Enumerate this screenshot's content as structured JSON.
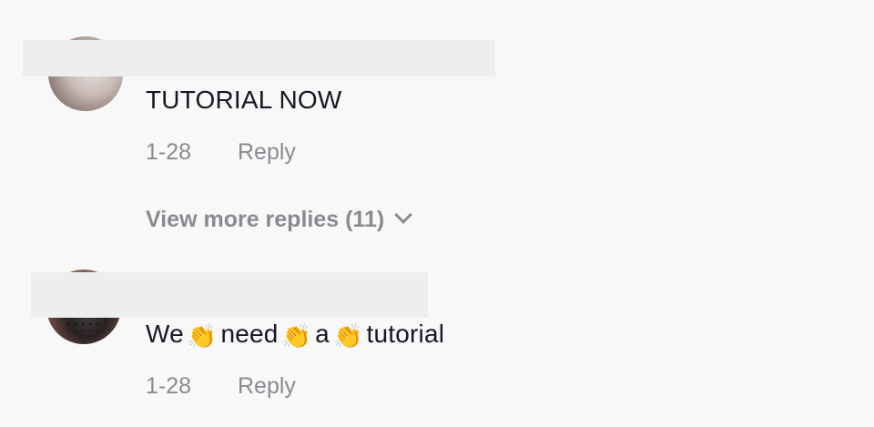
{
  "comments": [
    {
      "text": "TUTORIAL NOW",
      "date": "1-28",
      "reply_label": "Reply"
    },
    {
      "text_parts": [
        "We",
        "need",
        "a",
        "tutorial"
      ],
      "emoji": "👏",
      "date": "1-28",
      "reply_label": "Reply"
    }
  ],
  "view_more": {
    "label": "View more replies (11)",
    "icon": "chevron-down-icon"
  }
}
